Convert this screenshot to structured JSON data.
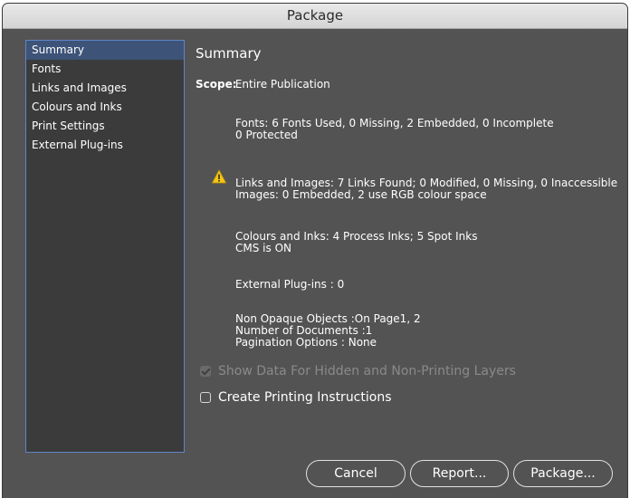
{
  "window": {
    "title": "Package"
  },
  "sidebar": {
    "items": [
      {
        "label": "Summary",
        "selected": true
      },
      {
        "label": "Fonts",
        "selected": false
      },
      {
        "label": "Links and Images",
        "selected": false
      },
      {
        "label": "Colours and Inks",
        "selected": false
      },
      {
        "label": "Print Settings",
        "selected": false
      },
      {
        "label": "External Plug-ins",
        "selected": false
      }
    ]
  },
  "summary": {
    "title": "Summary",
    "scope_label": "Scope:",
    "scope_value": "Entire Publication",
    "fonts": {
      "line1": "Fonts: 6 Fonts Used, 0 Missing, 2 Embedded, 0 Incomplete",
      "line2": "0 Protected"
    },
    "links": {
      "line1": "Links and Images: 7 Links Found; 0 Modified, 0 Missing, 0 Inaccessible",
      "line2": "Images: 0 Embedded, 2 use RGB colour space",
      "warning_icon": "warning-triangle-icon"
    },
    "colours": {
      "line1": "Colours and Inks: 4 Process Inks; 5 Spot Inks",
      "line2": "CMS is ON"
    },
    "plugins": {
      "line1": "External Plug-ins : 0"
    },
    "other": {
      "line1": "Non Opaque Objects :On Page1, 2",
      "line2": "Number of Documents :1",
      "line3": "Pagination Options : None"
    }
  },
  "options": {
    "show_hidden": {
      "label": "Show Data For Hidden and Non-Printing Layers",
      "checked": true,
      "enabled": false
    },
    "print_instructions": {
      "label": "Create Printing Instructions",
      "checked": false,
      "enabled": true
    }
  },
  "buttons": {
    "cancel": "Cancel",
    "report": "Report...",
    "package": "Package..."
  },
  "colors": {
    "dialog_bg": "#535353",
    "sidebar_bg": "#3b3b3b",
    "selection": "#3d5378",
    "focus_border": "#5f84c6",
    "warning": "#f5c518"
  }
}
